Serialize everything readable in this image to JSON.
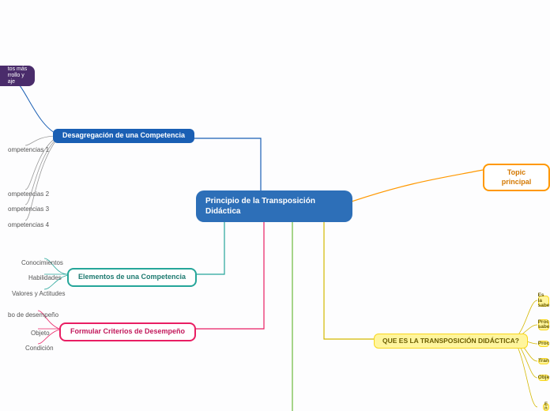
{
  "central": {
    "title": "Principio de la Transposición Didáctica"
  },
  "topic": {
    "label": "Topic principal"
  },
  "branches": {
    "desagregacion": {
      "label": "Desagregación de una Competencia"
    },
    "elementos": {
      "label": "Elementos de una Competencia"
    },
    "criterios": {
      "label": "Formular Criterios de Desempeño"
    },
    "que_es": {
      "label": "QUE ES LA TRANSPOSICIÓN DIDÁCTICA?"
    }
  },
  "purple_box": {
    "text": "tos más\nrrollo y\naje"
  },
  "comp_leaves": {
    "c1": "ompetencias 1",
    "c2": "ompetencias 2",
    "c3": "ompetencias 3",
    "c4": "ompetencias 4"
  },
  "elem_leaves": {
    "e1": "Conocimientos",
    "e2": "Habilidades",
    "e3": "Valores y Actitudes"
  },
  "crit_leaves": {
    "f1": "bo de desempeño",
    "f2": "Objeto",
    "f3": "Condición"
  },
  "right_leaves": {
    "r1": "Es la\nsabe",
    "r2": "Proc\nsabe",
    "r3": "Proc",
    "r4": "Tran",
    "r5": "Obje",
    "r6": "E\nn"
  }
}
